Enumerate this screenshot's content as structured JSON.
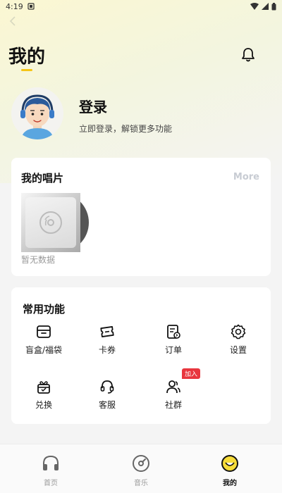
{
  "status_bar": {
    "time": "4:19"
  },
  "header": {
    "title": "我的"
  },
  "profile": {
    "login_label": "登录",
    "login_hint": "立即登录，解锁更多功能"
  },
  "records": {
    "title": "我的唱片",
    "more_label": "More",
    "empty_text": "暂无数据"
  },
  "features": {
    "title": "常用功能",
    "items": [
      {
        "label": "盲盒/福袋",
        "icon": "box-icon"
      },
      {
        "label": "卡券",
        "icon": "ticket-icon"
      },
      {
        "label": "订单",
        "icon": "order-icon"
      },
      {
        "label": "设置",
        "icon": "gear-icon"
      },
      {
        "label": "兑换",
        "icon": "gift-icon"
      },
      {
        "label": "客服",
        "icon": "headset-icon"
      },
      {
        "label": "社群",
        "icon": "community-icon"
      }
    ],
    "badge": "加入"
  },
  "tabs": [
    {
      "label": "首页",
      "icon": "headphones-icon",
      "active": false
    },
    {
      "label": "音乐",
      "icon": "disc-icon",
      "active": false
    },
    {
      "label": "我的",
      "icon": "smiley-icon",
      "active": true
    }
  ],
  "colors": {
    "accent": "#f5c517",
    "badge": "#e8363e"
  }
}
